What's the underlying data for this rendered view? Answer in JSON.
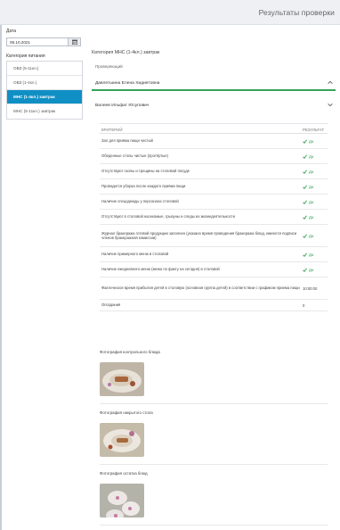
{
  "header": {
    "title": "Результаты проверки"
  },
  "filters": {
    "date_label": "Дата",
    "date_value": "08.10.2021",
    "category_label": "Категория питания",
    "categories": [
      {
        "label": "ОВЗ (5-11кл.)",
        "active": false
      },
      {
        "label": "ОВЗ (1-4кл.)",
        "active": false
      },
      {
        "label": "МНС (1-4кл.) завтрак",
        "active": true
      },
      {
        "label": "МНС (5-11кл.) завтрак",
        "active": false
      }
    ]
  },
  "main": {
    "title": "Категория МНС (1-4кл.) завтрак",
    "checker_label": "Проверяющий",
    "checkers": [
      "Давлетшина Елена Хидиятовна",
      "Валеев Ильфат Юсупович"
    ]
  },
  "table": {
    "col_criteria": "КРИТЕРИЙ",
    "col_result": "РЕЗУЛЬТАТ",
    "rows": [
      {
        "criteria": "Зал для приёма пищи чистый",
        "result": "Да",
        "check": true
      },
      {
        "criteria": "Обеденные столы чистые (протёртые)",
        "result": "Да",
        "check": true
      },
      {
        "criteria": "Отсутствуют сколы и трещины на столовой посуде",
        "result": "Да",
        "check": true
      },
      {
        "criteria": "Проводится уборка после каждого приёма пищи",
        "result": "Да",
        "check": true
      },
      {
        "criteria": "Наличие спецодежды у персонала столовой",
        "result": "Да",
        "check": true
      },
      {
        "criteria": "Отсутствуют в столовой насекомые, грызуны и следы их жизнедеятельности",
        "result": "Да",
        "check": true
      },
      {
        "criteria": "Журнал бракеража готовой продукции заполнен (указано время проведения бракеража блюд, имеются подписи членов бракеражной комиссии)",
        "result": "Да",
        "check": true
      },
      {
        "criteria": "Наличие примерного меню в столовой",
        "result": "Да",
        "check": true
      },
      {
        "criteria": "Наличие ежедневного меню (меню по факту на сегодня) в столовой",
        "result": "Да",
        "check": true
      },
      {
        "criteria": "Фактическое время прибытия детей в столовую (основная группа детей) в соответствии с графиком приема пищи",
        "result": "10:00:00",
        "check": false
      },
      {
        "criteria": "Опоздания",
        "result": "0",
        "check": false
      }
    ]
  },
  "photos": [
    {
      "label": "Фотография контрольного блюда"
    },
    {
      "label": "Фотография накрытого стола"
    },
    {
      "label": "Фотография остатка блюд"
    }
  ]
}
